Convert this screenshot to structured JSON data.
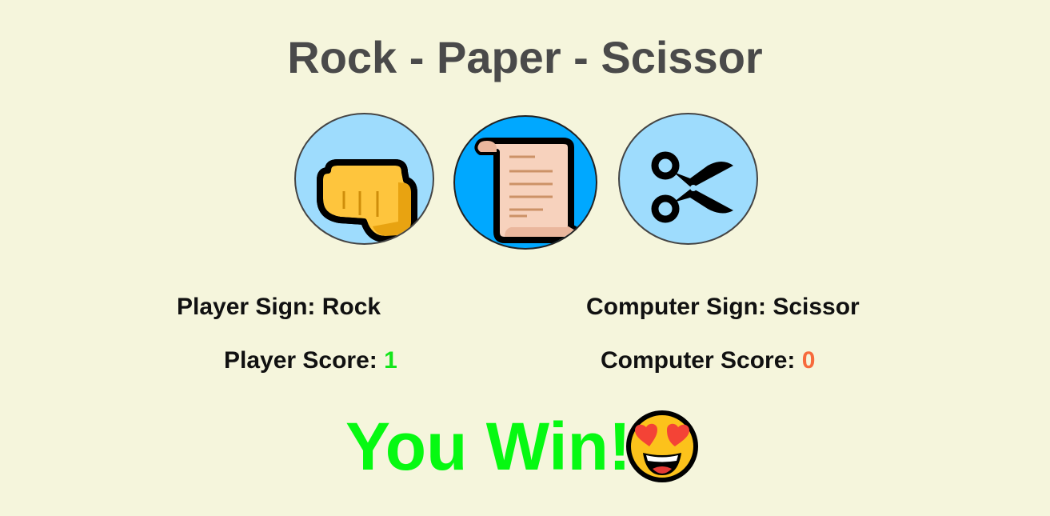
{
  "title": "Rock - Paper - Scissor",
  "choices": [
    {
      "id": "rock",
      "icon": "fist-icon",
      "selected": false
    },
    {
      "id": "paper",
      "icon": "scroll-icon",
      "selected": true
    },
    {
      "id": "scissor",
      "icon": "scissors-icon",
      "selected": false
    }
  ],
  "player": {
    "sign_label": "Player Sign: ",
    "sign_value": "Rock",
    "score_label": "Player Score: ",
    "score_value": "1"
  },
  "computer": {
    "sign_label": "Computer Sign: ",
    "sign_value": "Scissor",
    "score_label": "Computer Score: ",
    "score_value": "0"
  },
  "result": {
    "text": "You Win!",
    "emoji": "heart-eyes-emoji"
  },
  "colors": {
    "background": "#f5f5dc",
    "title": "#4a4a4a",
    "choice_bg": "#9edcfd",
    "choice_selected_bg": "#00a8ff",
    "win": "#06f912",
    "player_score": "#13e51a",
    "computer_score": "#f76a3c"
  }
}
